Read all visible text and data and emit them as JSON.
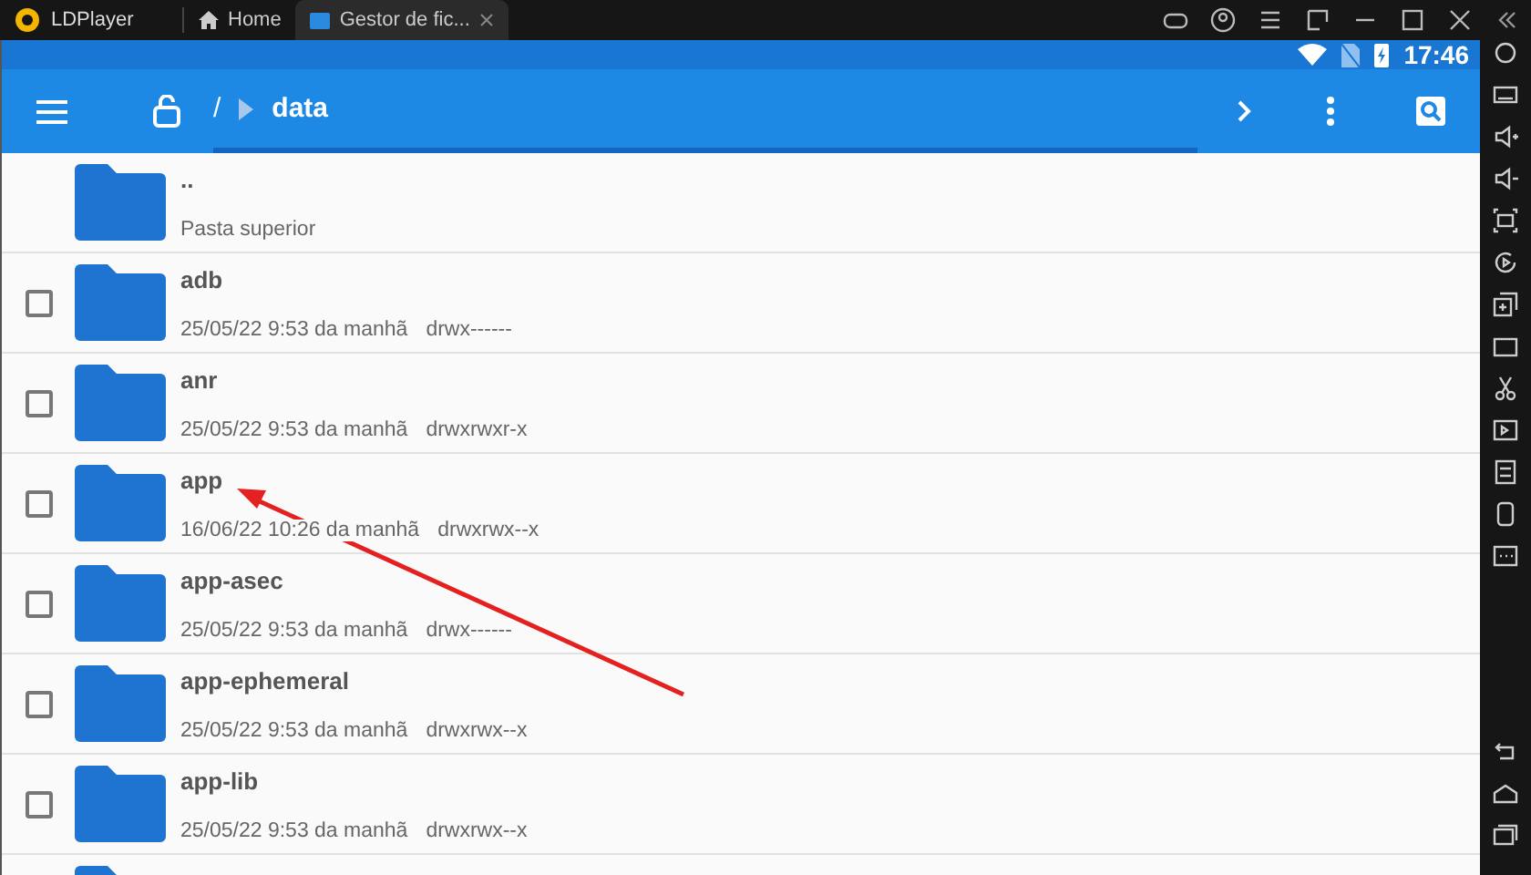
{
  "titlebar": {
    "app_name": "LDPlayer",
    "tabs": [
      {
        "label": "Home",
        "selected": false
      },
      {
        "label": "Gestor de fic...",
        "selected": true
      }
    ]
  },
  "status_bar": {
    "time": "17:46"
  },
  "toolbar": {
    "path_root": "/",
    "path_current": "data"
  },
  "files": [
    {
      "kind": "parent",
      "name": "..",
      "date": "Pasta superior"
    },
    {
      "kind": "folder",
      "name": "adb",
      "date": "25/05/22 9:53 da manhã",
      "perms": "drwx------",
      "checked": false
    },
    {
      "kind": "folder",
      "name": "anr",
      "date": "25/05/22 9:53 da manhã",
      "perms": "drwxrwxr-x",
      "checked": false
    },
    {
      "kind": "folder",
      "name": "app",
      "date": "16/06/22 10:26 da manhã",
      "perms": "drwxrwx--x",
      "checked": false
    },
    {
      "kind": "folder",
      "name": "app-asec",
      "date": "25/05/22 9:53 da manhã",
      "perms": "drwx------",
      "checked": false
    },
    {
      "kind": "folder",
      "name": "app-ephemeral",
      "date": "25/05/22 9:53 da manhã",
      "perms": "drwxrwx--x",
      "checked": false
    },
    {
      "kind": "folder",
      "name": "app-lib",
      "date": "25/05/22 9:53 da manhã",
      "perms": "drwxrwx--x",
      "checked": false
    }
  ]
}
